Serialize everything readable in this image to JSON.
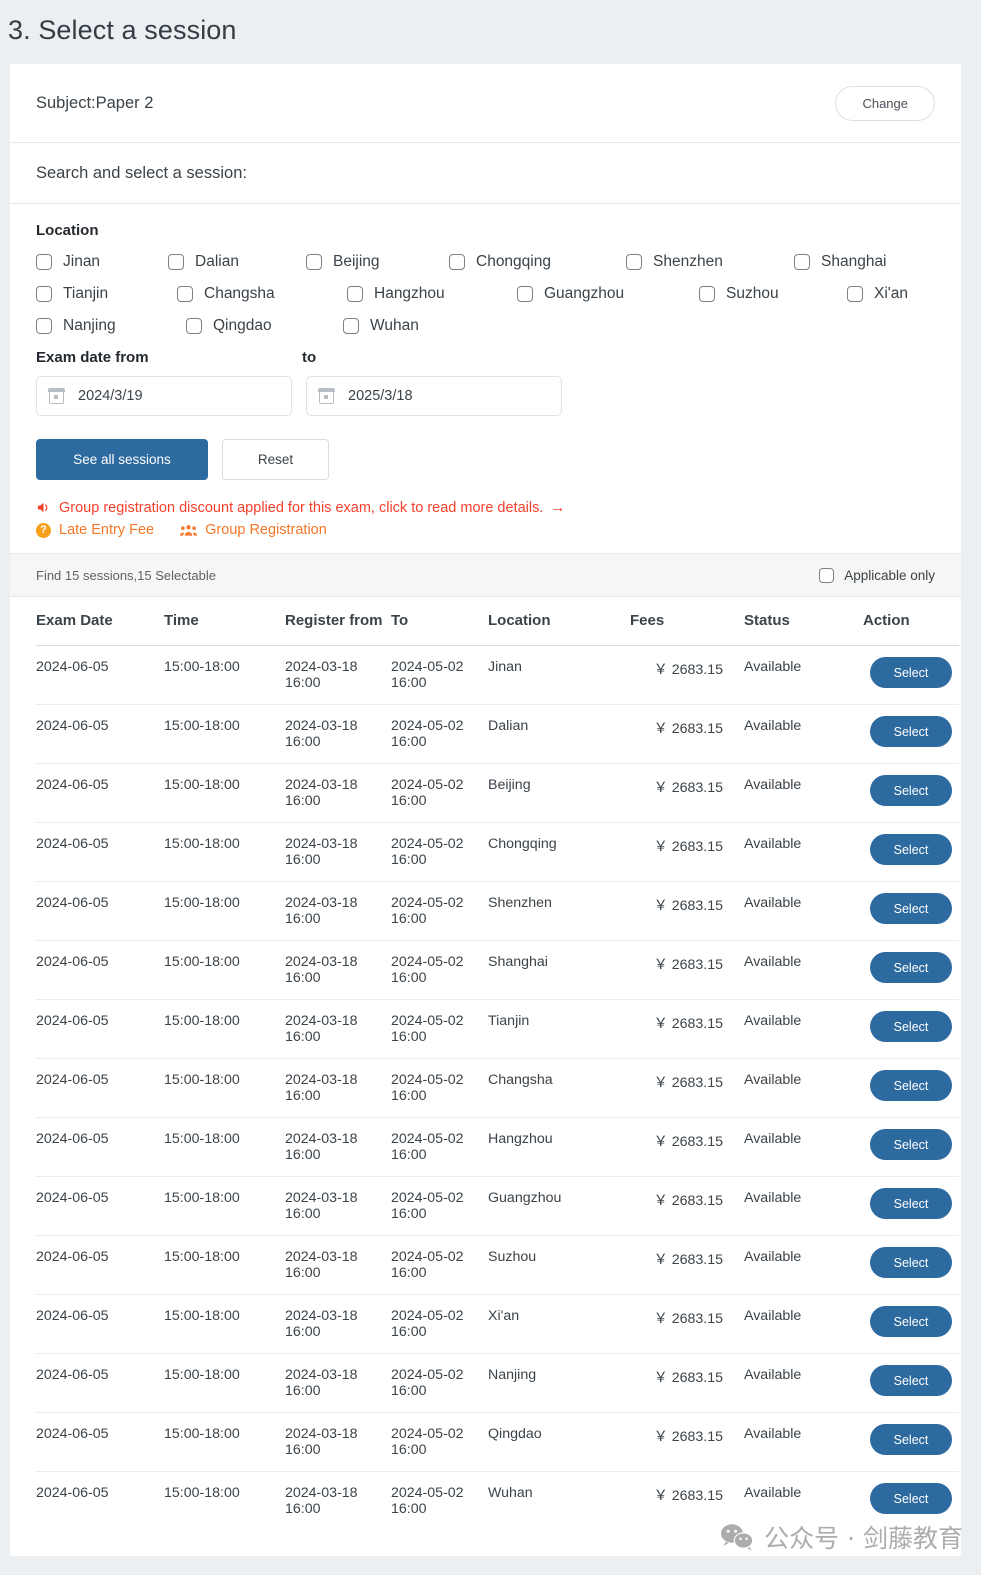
{
  "page": {
    "title": "3. Select a session"
  },
  "subject": {
    "label": "Subject:Paper 2",
    "change_button": "Change"
  },
  "search_prompt": "Search and select a session:",
  "filters": {
    "location_label": "Location",
    "locations": [
      [
        "Jinan",
        "Dalian",
        "Beijing",
        "Chongqing",
        "Shenzhen",
        "Shanghai"
      ],
      [
        "Tianjin",
        "Changsha",
        "Hangzhou",
        "Guangzhou",
        "Suzhou",
        "Xi'an"
      ],
      [
        "Nanjing",
        "Qingdao",
        "Wuhan"
      ]
    ],
    "exam_date_from_label": "Exam date from",
    "exam_date_to_label": "to",
    "date_from_value": "2024/3/19",
    "date_to_value": "2025/3/18",
    "see_all_button": "See all sessions",
    "reset_button": "Reset"
  },
  "notices": {
    "discount": "Group registration discount applied for this exam, click to read more details.",
    "discount_arrow": "→",
    "late_entry_fee": "Late Entry Fee",
    "group_registration": "Group Registration",
    "question_mark": "?",
    "discount_color": "#f5402c",
    "legend_color": "#f5772a"
  },
  "findbar": {
    "summary": "Find 15 sessions,15 Selectable",
    "applicable_only": "Applicable only"
  },
  "table": {
    "headers": {
      "exam_date": "Exam Date",
      "time": "Time",
      "register_from": "Register from",
      "to": "To",
      "location": "Location",
      "fees": "Fees",
      "status": "Status",
      "action": "Action"
    },
    "select_label": "Select",
    "rows": [
      {
        "exam_date": "2024-06-05",
        "time": "15:00-18:00",
        "register_from": "2024-03-18 16:00",
        "to": "2024-05-02 16:00",
        "location": "Jinan",
        "fees": "￥ 2683.15",
        "status": "Available",
        "action": "Select"
      },
      {
        "exam_date": "2024-06-05",
        "time": "15:00-18:00",
        "register_from": "2024-03-18 16:00",
        "to": "2024-05-02 16:00",
        "location": "Dalian",
        "fees": "￥ 2683.15",
        "status": "Available",
        "action": "Select"
      },
      {
        "exam_date": "2024-06-05",
        "time": "15:00-18:00",
        "register_from": "2024-03-18 16:00",
        "to": "2024-05-02 16:00",
        "location": "Beijing",
        "fees": "￥ 2683.15",
        "status": "Available",
        "action": "Select"
      },
      {
        "exam_date": "2024-06-05",
        "time": "15:00-18:00",
        "register_from": "2024-03-18 16:00",
        "to": "2024-05-02 16:00",
        "location": "Chongqing",
        "fees": "￥ 2683.15",
        "status": "Available",
        "action": "Select"
      },
      {
        "exam_date": "2024-06-05",
        "time": "15:00-18:00",
        "register_from": "2024-03-18 16:00",
        "to": "2024-05-02 16:00",
        "location": "Shenzhen",
        "fees": "￥ 2683.15",
        "status": "Available",
        "action": "Select"
      },
      {
        "exam_date": "2024-06-05",
        "time": "15:00-18:00",
        "register_from": "2024-03-18 16:00",
        "to": "2024-05-02 16:00",
        "location": "Shanghai",
        "fees": "￥ 2683.15",
        "status": "Available",
        "action": "Select"
      },
      {
        "exam_date": "2024-06-05",
        "time": "15:00-18:00",
        "register_from": "2024-03-18 16:00",
        "to": "2024-05-02 16:00",
        "location": "Tianjin",
        "fees": "￥ 2683.15",
        "status": "Available",
        "action": "Select"
      },
      {
        "exam_date": "2024-06-05",
        "time": "15:00-18:00",
        "register_from": "2024-03-18 16:00",
        "to": "2024-05-02 16:00",
        "location": "Changsha",
        "fees": "￥ 2683.15",
        "status": "Available",
        "action": "Select"
      },
      {
        "exam_date": "2024-06-05",
        "time": "15:00-18:00",
        "register_from": "2024-03-18 16:00",
        "to": "2024-05-02 16:00",
        "location": "Hangzhou",
        "fees": "￥ 2683.15",
        "status": "Available",
        "action": "Select"
      },
      {
        "exam_date": "2024-06-05",
        "time": "15:00-18:00",
        "register_from": "2024-03-18 16:00",
        "to": "2024-05-02 16:00",
        "location": "Guangzhou",
        "fees": "￥ 2683.15",
        "status": "Available",
        "action": "Select"
      },
      {
        "exam_date": "2024-06-05",
        "time": "15:00-18:00",
        "register_from": "2024-03-18 16:00",
        "to": "2024-05-02 16:00",
        "location": "Suzhou",
        "fees": "￥ 2683.15",
        "status": "Available",
        "action": "Select"
      },
      {
        "exam_date": "2024-06-05",
        "time": "15:00-18:00",
        "register_from": "2024-03-18 16:00",
        "to": "2024-05-02 16:00",
        "location": "Xi'an",
        "fees": "￥ 2683.15",
        "status": "Available",
        "action": "Select"
      },
      {
        "exam_date": "2024-06-05",
        "time": "15:00-18:00",
        "register_from": "2024-03-18 16:00",
        "to": "2024-05-02 16:00",
        "location": "Nanjing",
        "fees": "￥ 2683.15",
        "status": "Available",
        "action": "Select"
      },
      {
        "exam_date": "2024-06-05",
        "time": "15:00-18:00",
        "register_from": "2024-03-18 16:00",
        "to": "2024-05-02 16:00",
        "location": "Qingdao",
        "fees": "￥ 2683.15",
        "status": "Available",
        "action": "Select"
      },
      {
        "exam_date": "2024-06-05",
        "time": "15:00-18:00",
        "register_from": "2024-03-18 16:00",
        "to": "2024-05-02 16:00",
        "location": "Wuhan",
        "fees": "￥ 2683.15",
        "status": "Available",
        "action": "Select"
      }
    ]
  },
  "watermark": {
    "text": "公众号 · 剑藤教育"
  },
  "colors": {
    "primary": "#2d6a9f",
    "page_bg": "#eceff1",
    "available": "#4aa048"
  }
}
